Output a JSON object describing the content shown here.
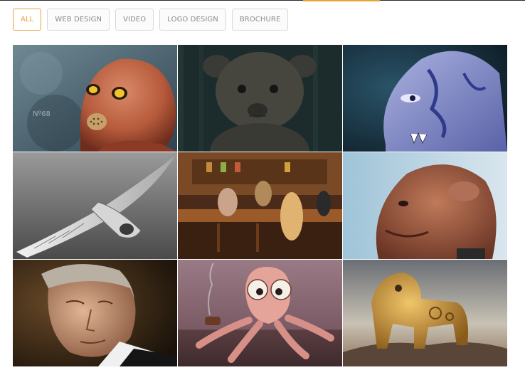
{
  "filters": {
    "items": [
      {
        "label": "ALL",
        "active": true
      },
      {
        "label": "WEB DESIGN",
        "active": false
      },
      {
        "label": "VIDEO",
        "active": false
      },
      {
        "label": "LOGO DESIGN",
        "active": false
      },
      {
        "label": "BROCHURE",
        "active": false
      }
    ]
  },
  "colors": {
    "accent": "#e8a33a",
    "top_rule": "#2a2a2a",
    "button_border": "#d8d8d8",
    "button_text": "#8b8b8b"
  },
  "gallery": {
    "tiles": [
      {
        "subject": "red-robot-mask-image",
        "watermark": "Nº68"
      },
      {
        "subject": "dark-teddy-bear-image"
      },
      {
        "subject": "blue-tattooed-creature-image"
      },
      {
        "subject": "mechanical-bird-image"
      },
      {
        "subject": "cartoon-bar-scene-image"
      },
      {
        "subject": "monster-portrait-image"
      },
      {
        "subject": "old-man-portrait-image"
      },
      {
        "subject": "pink-octopus-image"
      },
      {
        "subject": "steampunk-lion-image"
      }
    ]
  }
}
